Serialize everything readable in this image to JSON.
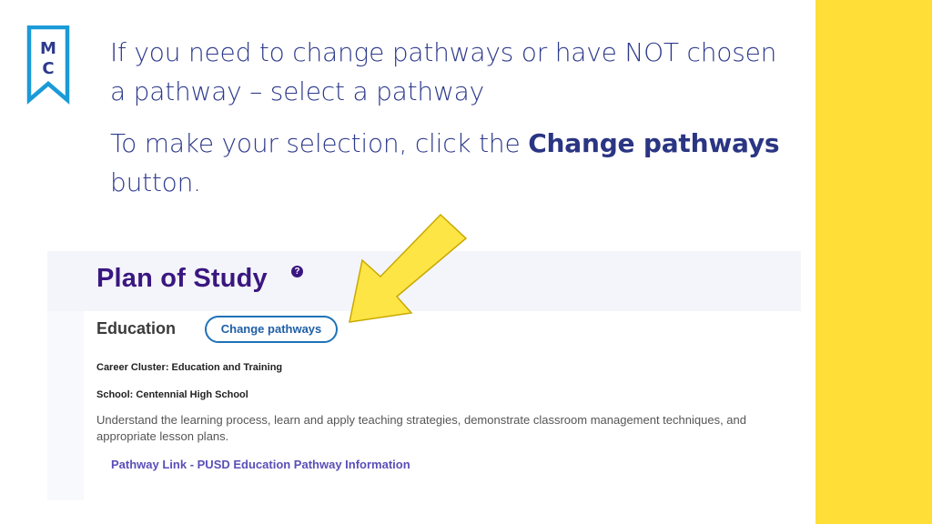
{
  "slide": {
    "heading": "If you need to change pathways or have NOT chosen a pathway – select a pathway",
    "instruction_prefix": "To make your selection, click the ",
    "instruction_bold": "Change pathways",
    "instruction_suffix": " button.",
    "logo_text": "MC",
    "accent_color": "#ffde38",
    "text_color": "#2e3a8c"
  },
  "screenshot": {
    "title": "Plan of Study",
    "help_icon": "question-circle-icon",
    "pathway_name": "Education",
    "change_button_label": "Change pathways",
    "career_cluster": "Career Cluster: Education and Training",
    "school": "School: Centennial High School",
    "description": "Understand the learning process, learn and apply teaching strategies, demonstrate classroom management techniques, and appropriate lesson plans.",
    "link_text": "Pathway Link - PUSD Education Pathway Information",
    "title_color": "#3a1780",
    "button_color": "#1f72b8",
    "link_color": "#5a4fb8"
  },
  "callout": {
    "arrow_icon": "arrow-pointer-icon",
    "arrow_color": "#fde545"
  }
}
